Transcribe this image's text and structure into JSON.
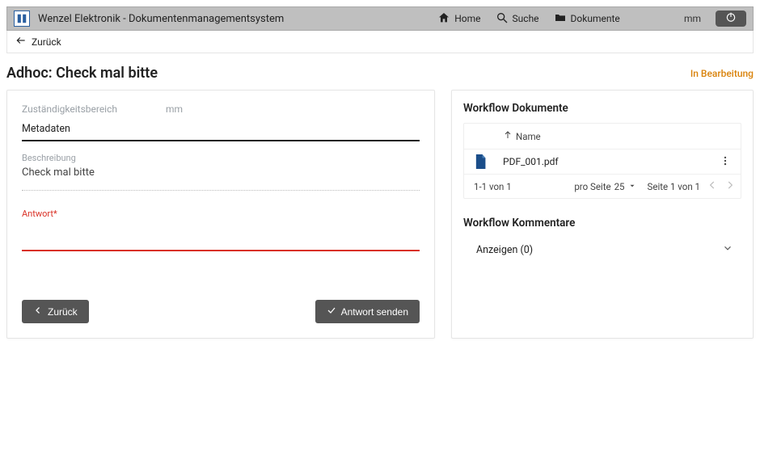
{
  "topbar": {
    "app_title": "Wenzel Elektronik - Dokumentenmanagementsystem",
    "nav": {
      "home": "Home",
      "search": "Suche",
      "documents": "Dokumente"
    },
    "user": "mm"
  },
  "back": {
    "label": "Zurück"
  },
  "header": {
    "title": "Adhoc: Check mal bitte",
    "status": "In Bearbeitung"
  },
  "left": {
    "zust_label": "Zuständigkeitsbereich",
    "zust_value": "mm",
    "tab_meta": "Metadaten",
    "desc_label": "Beschreibung",
    "desc_value": "Check mal bitte",
    "answer_label": "Antwort*",
    "btn_back": "Zurück",
    "btn_send": "Antwort senden"
  },
  "right": {
    "docs_title": "Workflow Dokumente",
    "col_name": "Name",
    "file_name": "PDF_001.pdf",
    "range": "1-1 von 1",
    "perpage_label": "pro Seite",
    "perpage_value": "25",
    "page_info": "Seite 1 von 1",
    "comments_title": "Workflow Kommentare",
    "comments_toggle": "Anzeigen (0)"
  }
}
